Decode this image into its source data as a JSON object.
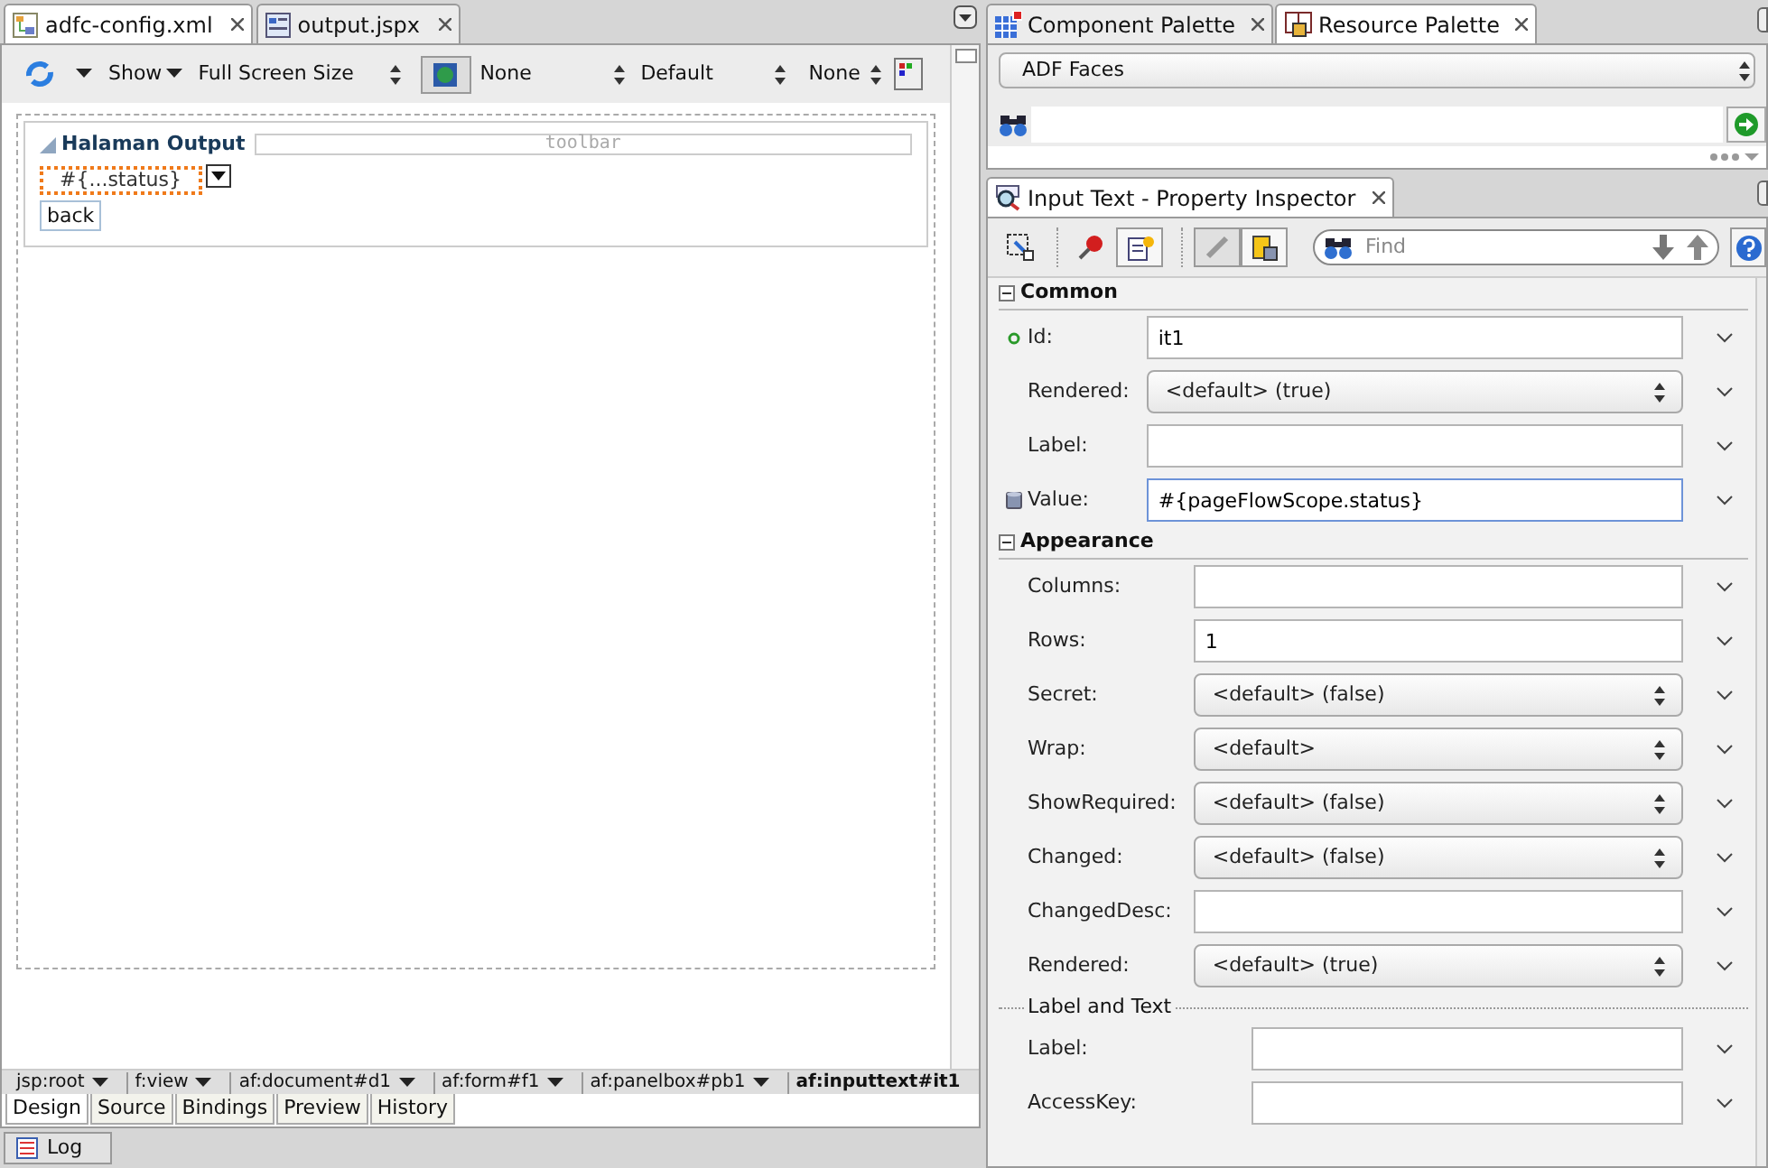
{
  "editor_tabs": [
    {
      "label": "adfc-config.xml",
      "kind": "diagram",
      "selected": false
    },
    {
      "label": "output.jspx",
      "kind": "page",
      "selected": true
    }
  ],
  "design_toolbar": {
    "show": "Show",
    "size": "Full Screen Size",
    "skin": "None",
    "style": "Default",
    "style_2": "None"
  },
  "canvas": {
    "panel_title": "Halaman Output",
    "toolbar_facet": "toolbar",
    "input_text": "#{...status}",
    "button": "back"
  },
  "breadcrumbs": [
    {
      "label": "jsp:root",
      "selected": false
    },
    {
      "label": "f:view",
      "selected": false
    },
    {
      "label": "af:document#d1",
      "selected": false
    },
    {
      "label": "af:form#f1",
      "selected": false
    },
    {
      "label": "af:panelbox#pb1",
      "selected": false
    },
    {
      "label": "af:inputtext#it1",
      "selected": true
    }
  ],
  "view_tabs": [
    {
      "label": "Design",
      "selected": true
    },
    {
      "label": "Source",
      "selected": false
    },
    {
      "label": "Bindings",
      "selected": false
    },
    {
      "label": "Preview",
      "selected": false
    },
    {
      "label": "History",
      "selected": false
    }
  ],
  "log_button": "Log",
  "palette_tabs": [
    {
      "label": "Component Palette",
      "kind": "grid",
      "selected": false
    },
    {
      "label": "Resource Palette",
      "kind": "book",
      "selected": true
    }
  ],
  "palette_library": "ADF Faces",
  "inspector": {
    "title": "Input Text - Property Inspector",
    "find_placeholder": "Find",
    "sections": [
      {
        "title": "Common",
        "expanded": true,
        "rows": [
          {
            "kind": "text",
            "label": "Id:",
            "value": "it1",
            "required": true,
            "focused": false
          },
          {
            "kind": "select",
            "label": "Rendered:",
            "value": "<default> (true)"
          },
          {
            "kind": "text",
            "label": "Label:",
            "value": "",
            "focused": false
          },
          {
            "kind": "text",
            "label": "Value:",
            "value": "#{pageFlowScope.status}",
            "bound": true,
            "focused": true
          }
        ]
      },
      {
        "title": "Appearance",
        "expanded": true,
        "rows": [
          {
            "kind": "text",
            "label": "Columns:",
            "value": "",
            "focused": false
          },
          {
            "kind": "text",
            "label": "Rows:",
            "value": "1",
            "focused": false
          },
          {
            "kind": "select",
            "label": "Secret:",
            "value": "<default> (false)"
          },
          {
            "kind": "select",
            "label": "Wrap:",
            "value": "<default>"
          },
          {
            "kind": "select",
            "label": "ShowRequired:",
            "value": "<default> (false)"
          },
          {
            "kind": "select",
            "label": "Changed:",
            "value": "<default> (false)"
          },
          {
            "kind": "text",
            "label": "ChangedDesc:",
            "value": "",
            "focused": false
          },
          {
            "kind": "select",
            "label": "Rendered:",
            "value": "<default> (true)"
          }
        ],
        "subgroups": [
          {
            "title": "Label and Text",
            "rows": [
              {
                "kind": "text",
                "label": "Label:",
                "value": "",
                "focused": false
              },
              {
                "kind": "text",
                "label": "AccessKey:",
                "value": "",
                "focused": false
              }
            ]
          }
        ]
      }
    ]
  }
}
